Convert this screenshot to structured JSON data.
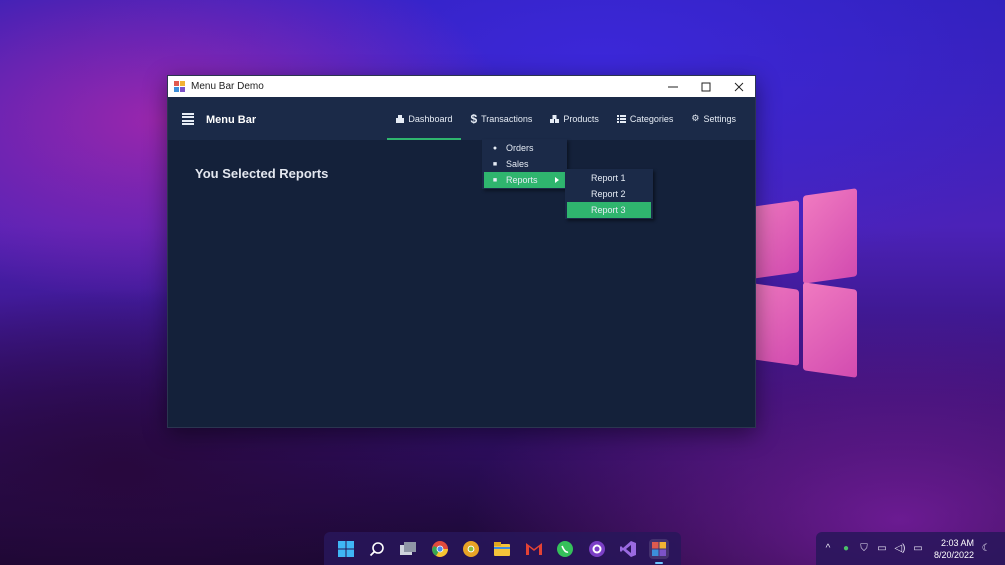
{
  "window": {
    "title": "Menu Bar Demo",
    "controls": {
      "minimize": "—",
      "maximize": "☐",
      "close": "✕"
    }
  },
  "menubar": {
    "brand": "Menu Bar",
    "items": [
      {
        "label": "Dashboard",
        "icon": "dashboard-icon"
      },
      {
        "label": "Transactions",
        "icon": "dollar-icon"
      },
      {
        "label": "Products",
        "icon": "products-icon"
      },
      {
        "label": "Categories",
        "icon": "list-icon"
      },
      {
        "label": "Settings",
        "icon": "gear-icon"
      }
    ],
    "active_item": "Dashboard"
  },
  "dropdown": {
    "items": [
      {
        "label": "Orders",
        "icon": "tag-icon"
      },
      {
        "label": "Sales",
        "icon": "document-icon"
      },
      {
        "label": "Reports",
        "icon": "report-icon"
      }
    ],
    "highlighted": "Reports"
  },
  "submenu": {
    "items": [
      {
        "label": "Report 1"
      },
      {
        "label": "Report 2"
      },
      {
        "label": "Report 3"
      }
    ],
    "highlighted": "Report 3"
  },
  "content": {
    "title": "You Selected Reports"
  },
  "colors": {
    "accent": "#2fb56e",
    "menubar_bg": "#1b2a48",
    "content_bg": "#14213a"
  },
  "taskbar": {
    "apps": [
      "windows-start-icon",
      "search-icon",
      "task-view-icon",
      "chrome-icon",
      "chrome-canary-icon",
      "file-explorer-icon",
      "gmail-icon",
      "whatsapp-icon",
      "github-icon",
      "visual-studio-icon",
      "menu-bar-demo-icon"
    ]
  },
  "tray": {
    "time": "2:03 AM",
    "date": "8/20/2022"
  }
}
